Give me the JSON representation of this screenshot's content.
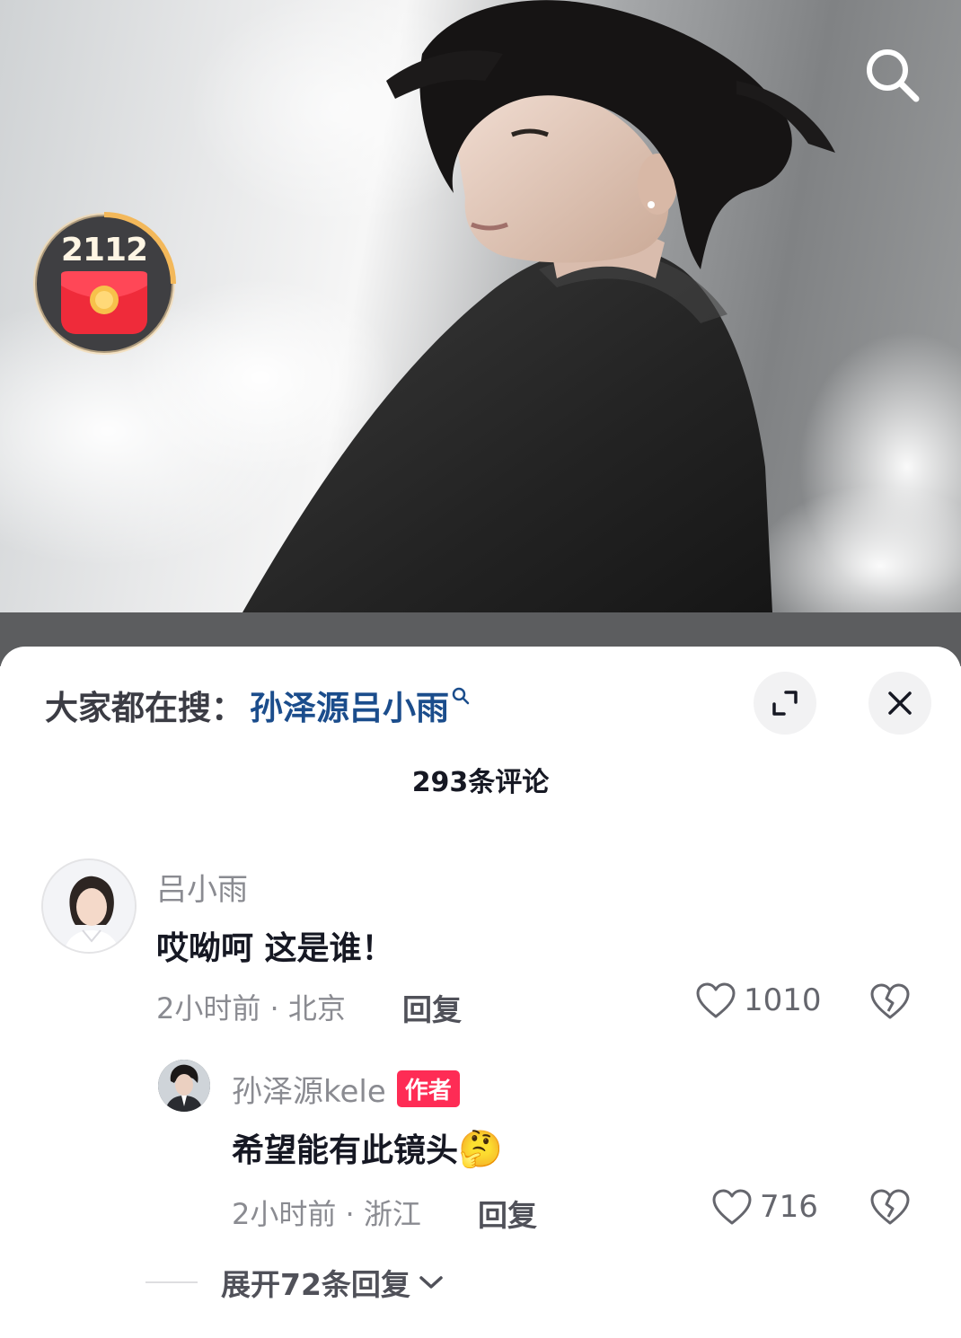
{
  "photo": {
    "search_icon": "search-icon",
    "reward": {
      "count": "2112",
      "icon": "red-envelope-icon"
    }
  },
  "sheet": {
    "hot_search": {
      "prefix": "大家都在搜：",
      "term": "孙泽源吕小雨",
      "icon": "small-search-icon"
    },
    "expand_icon": "fullscreen-expand-icon",
    "close_icon": "close-icon",
    "comment_count": "293条评论"
  },
  "comments": [
    {
      "name": "吕小雨",
      "text": "哎呦呵 这是谁！",
      "meta": "2小时前 · 北京",
      "reply_label": "回复",
      "likes": "1010"
    }
  ],
  "replies": [
    {
      "name": "孙泽源kele",
      "badge": "作者",
      "text": "希望能有此镜头",
      "emoji": "🤔",
      "meta": "2小时前 · 浙江",
      "reply_label": "回复",
      "likes": "716"
    }
  ],
  "expand_replies": "展开72条回复",
  "colors": {
    "accent_red": "#fe2c55",
    "hot_search_blue": "#1b4d8c",
    "text_primary": "#161823",
    "text_secondary": "#8a8b91"
  }
}
